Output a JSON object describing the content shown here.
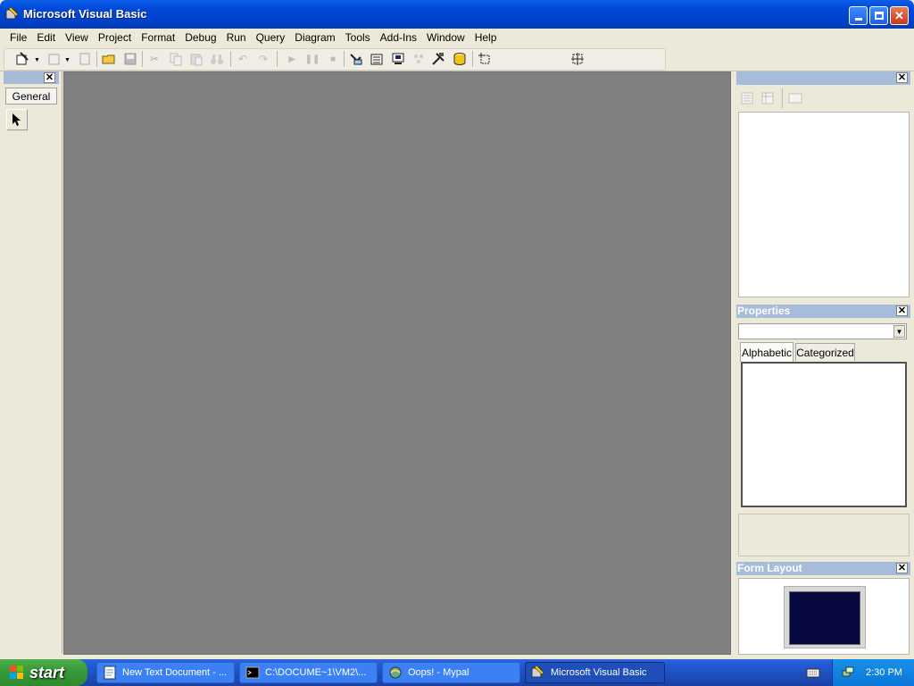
{
  "window": {
    "title": "Microsoft Visual Basic"
  },
  "menu": [
    "File",
    "Edit",
    "View",
    "Project",
    "Format",
    "Debug",
    "Run",
    "Query",
    "Diagram",
    "Tools",
    "Add-Ins",
    "Window",
    "Help"
  ],
  "toolbox": {
    "tab": "General"
  },
  "properties": {
    "title": "Properties",
    "tabs": [
      "Alphabetic",
      "Categorized"
    ],
    "selected_object": ""
  },
  "form_layout": {
    "title": "Form Layout"
  },
  "taskbar": {
    "start": "start",
    "tasks": [
      "New Text Document - ...",
      "C:\\DOCUME~1\\VM2\\...",
      "Oops! - Mypal",
      "Microsoft Visual Basic"
    ],
    "active_task": "Microsoft Visual Basic",
    "clock": "2:30 PM"
  },
  "colors": {
    "title_bar": "#0a5ee8",
    "pane_header": "#a7bcd9",
    "mdi_background": "#808080",
    "taskbar": "#245edb",
    "start_button": "#3a9a3a"
  }
}
